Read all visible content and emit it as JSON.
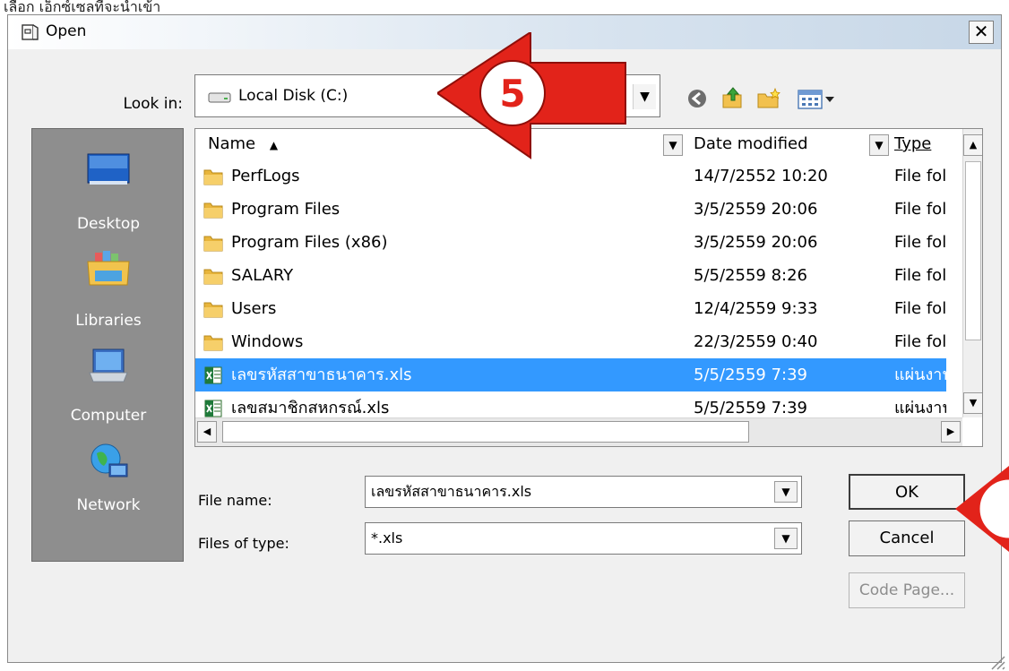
{
  "caption": "เลือก เอ็กซ์เซลที่จะนำเข้า",
  "dialog": {
    "title": "Open",
    "close_glyph": "✕"
  },
  "look_in": {
    "label": "Look in:",
    "value": "Local Disk (C:)"
  },
  "toolbar_icons": [
    "back-icon",
    "up-folder-icon",
    "new-folder-icon",
    "view-menu-icon"
  ],
  "places": [
    {
      "label": "Desktop",
      "icon": "desktop-icon"
    },
    {
      "label": "Libraries",
      "icon": "libraries-icon"
    },
    {
      "label": "Computer",
      "icon": "computer-icon"
    },
    {
      "label": "Network",
      "icon": "network-icon"
    }
  ],
  "columns": {
    "name": "Name",
    "date": "Date modified",
    "type": "Type"
  },
  "files": [
    {
      "name": "PerfLogs",
      "date": "14/7/2552 10:20",
      "type": "File fol",
      "kind": "folder"
    },
    {
      "name": "Program Files",
      "date": "3/5/2559 20:06",
      "type": "File fol",
      "kind": "folder"
    },
    {
      "name": "Program Files (x86)",
      "date": "3/5/2559 20:06",
      "type": "File fol",
      "kind": "folder"
    },
    {
      "name": "SALARY",
      "date": "5/5/2559 8:26",
      "type": "File fol",
      "kind": "folder"
    },
    {
      "name": "Users",
      "date": "12/4/2559 9:33",
      "type": "File fol",
      "kind": "folder"
    },
    {
      "name": "Windows",
      "date": "22/3/2559 0:40",
      "type": "File fol",
      "kind": "folder"
    },
    {
      "name": "เลขรหัสสาขาธนาคาร.xls",
      "date": "5/5/2559 7:39",
      "type": "แผ่นงาน",
      "kind": "excel",
      "selected": true
    },
    {
      "name": "เลขสมาชิกสหกรณ์.xls",
      "date": "5/5/2559 7:39",
      "type": "แผ่นงาน",
      "kind": "excel"
    }
  ],
  "form": {
    "file_name_label": "File name:",
    "file_name_value": "เลขรหัสสาขาธนาคาร.xls",
    "file_type_label": "Files of type:",
    "file_type_value": "*.xls"
  },
  "buttons": {
    "ok": "OK",
    "cancel": "Cancel",
    "code_page": "Code Page..."
  },
  "annotation": {
    "step": "5",
    "color": "#e2231a"
  },
  "colors": {
    "selection": "#3399ff",
    "places_bg": "#8e8e8e",
    "folder": "#e8b53c"
  }
}
